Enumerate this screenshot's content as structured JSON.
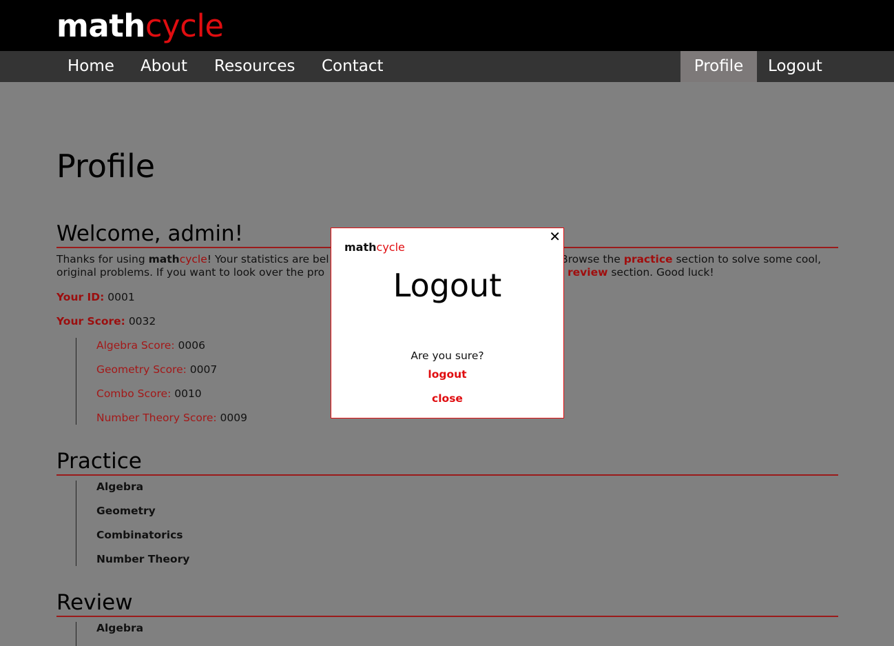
{
  "logo": {
    "bold": "math",
    "accent": "cycle"
  },
  "nav": {
    "left": [
      "Home",
      "About",
      "Resources",
      "Contact"
    ],
    "profile": "Profile",
    "logout": "Logout"
  },
  "page": {
    "title": "Profile"
  },
  "welcome": {
    "heading": "Welcome, admin!",
    "text_1": "Thanks for using ",
    "brand_bold": "math",
    "brand_accent": "cycle",
    "text_2": "! Your statistics are bel",
    "text_3": "Browse the ",
    "practice_link": "practice",
    "text_4": " section to solve some cool,",
    "text_5": "original problems. If you want to look over the pro",
    "review_link": "review",
    "text_6": " section. Good luck!"
  },
  "stats": {
    "id_label": "Your ID:",
    "id_value": " 0001",
    "score_label": "Your Score:",
    "score_value": " 0032",
    "subs": [
      {
        "label": "Algebra Score:",
        "value": " 0006"
      },
      {
        "label": "Geometry Score:",
        "value": " 0007"
      },
      {
        "label": "Combo Score:",
        "value": " 0010"
      },
      {
        "label": "Number Theory Score:",
        "value": " 0009"
      }
    ]
  },
  "practice": {
    "heading": "Practice",
    "items": [
      "Algebra",
      "Geometry",
      "Combinatorics",
      "Number Theory"
    ]
  },
  "review": {
    "heading": "Review",
    "items": [
      "Algebra"
    ]
  },
  "modal": {
    "close": "✕",
    "logo_bold": "math",
    "logo_accent": "cycle",
    "title": "Logout",
    "question": "Are you sure?",
    "logout_label": "logout",
    "close_label": "close"
  },
  "colors": {
    "accent": "#e00d10",
    "dark_red": "#9b1a1a",
    "overlay": "#808080",
    "topbar": "#000000",
    "navbar": "#343434"
  }
}
